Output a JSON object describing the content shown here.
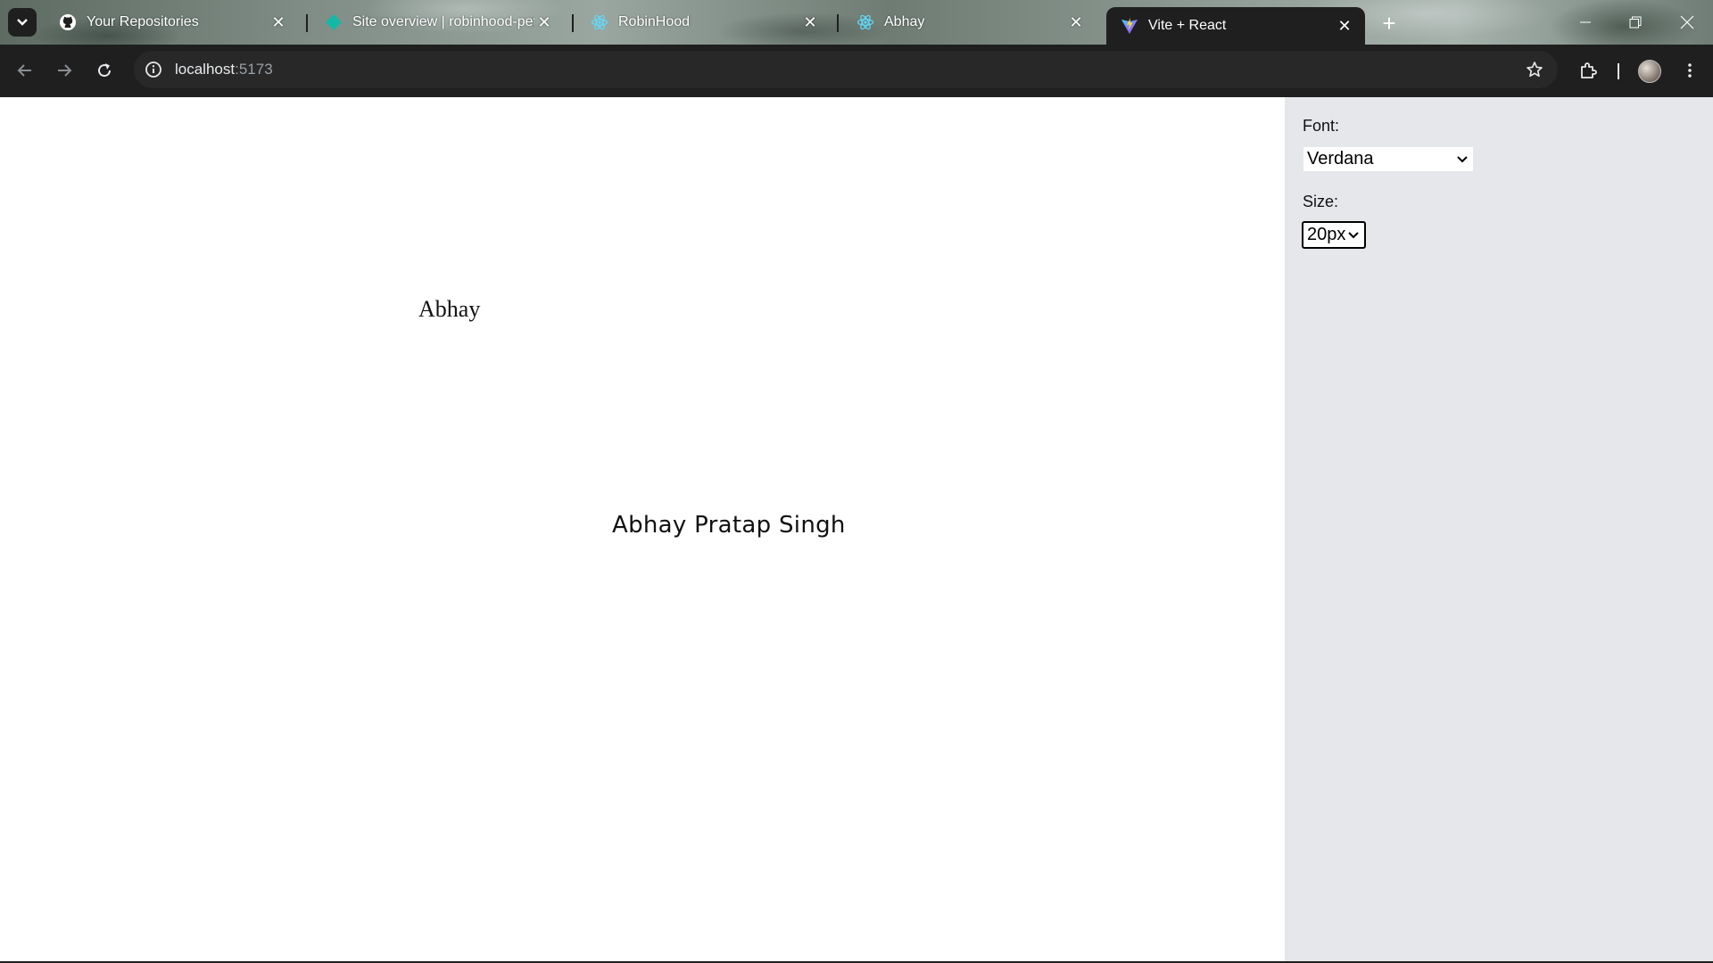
{
  "browser": {
    "tabs": [
      {
        "title": "Your Repositories",
        "icon": "github-icon",
        "active": false
      },
      {
        "title": "Site overview | robinhood-pets",
        "icon": "netlify-icon",
        "active": false
      },
      {
        "title": "RobinHood",
        "icon": "react-icon",
        "active": false
      },
      {
        "title": "Abhay",
        "icon": "react-icon",
        "active": false
      },
      {
        "title": "Vite + React",
        "icon": "vite-icon",
        "active": true
      }
    ],
    "close_glyph": "✕",
    "new_tab_glyph": "+",
    "address": {
      "host": "localhost",
      "port": ":5173"
    }
  },
  "page": {
    "preview_top_text": "Abhay",
    "preview_main_text": "Abhay Pratap Singh",
    "sidebar": {
      "font_label": "Font:",
      "font_value": "Verdana",
      "size_label": "Size:",
      "size_value": "20px"
    }
  },
  "colors": {
    "sidebar_bg": "#e5e7eb",
    "chrome_bg": "#1f1f1f",
    "page_bg": "#ffffff"
  }
}
